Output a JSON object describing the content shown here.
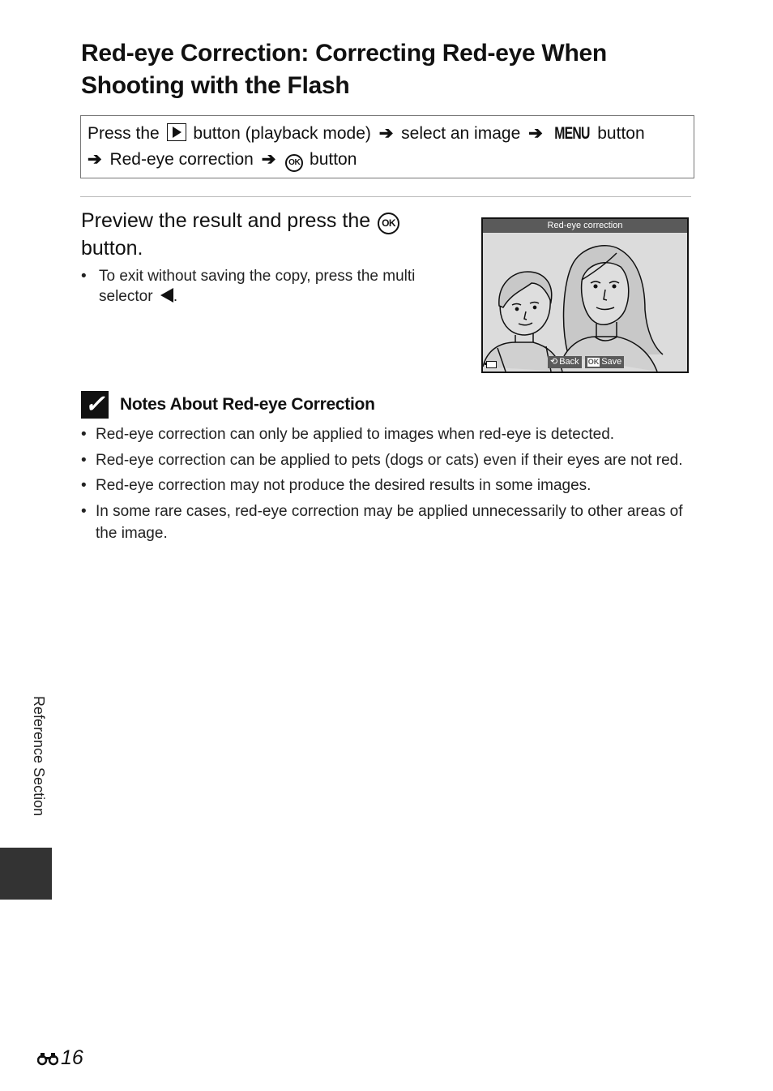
{
  "page": {
    "title": "Red-eye Correction: Correcting Red-eye When Shooting with the Flash",
    "procedure": {
      "line1": {
        "press_the": "Press the",
        "playback_icon": "playback-button-icon",
        "after_playback": "button (playback mode)",
        "select_image": "select an image",
        "menu_glyph": "MENU",
        "after_menu": "button"
      },
      "line2": {
        "menu_item": "Red-eye correction",
        "ok_glyph": "OK",
        "after_ok": "button"
      },
      "arrow": "➔"
    },
    "step": {
      "heading_part1": "Preview the result and press the",
      "ok_glyph": "OK",
      "heading_part2": "button.",
      "bullet_part1": "To exit without saving the copy, press the multi selector",
      "bullet_end": "."
    },
    "camera_screen": {
      "title": "Red-eye correction",
      "back_label": "Back",
      "ok_label": "OK",
      "save_label": "Save",
      "battery_icon": "battery-icon"
    },
    "notes": {
      "icon": "check-icon",
      "title": "Notes About Red-eye Correction",
      "items": [
        "Red-eye correction can only be applied to images when red-eye is detected.",
        "Red-eye correction can be applied to pets (dogs or cats) even if their eyes are not red.",
        "Red-eye correction may not produce the desired results in some images.",
        "In some rare cases, red-eye correction may be applied unnecessarily to other areas of the image."
      ]
    },
    "side_label": "Reference Section",
    "page_number": "16",
    "page_number_icon": "reference-binoculars-icon"
  }
}
